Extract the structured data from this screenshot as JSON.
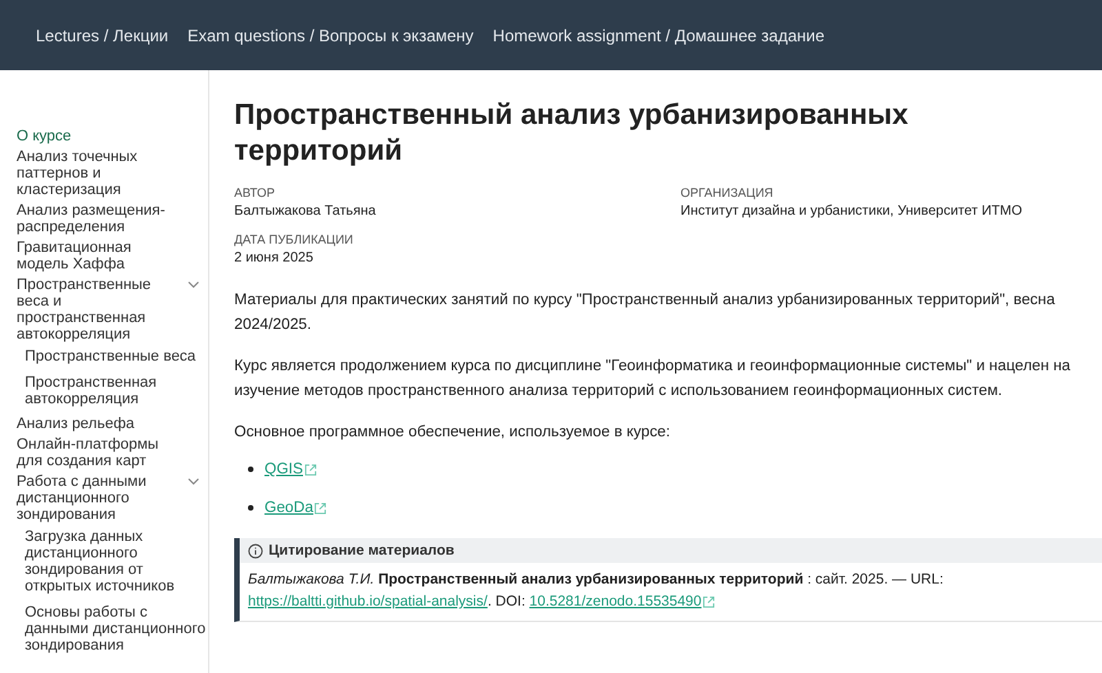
{
  "nav": [
    {
      "label": "Lectures / Лекции",
      "selected": false
    },
    {
      "label": "Exam questions / Вопросы к экзамену",
      "selected": false
    },
    {
      "label": "Homework assignment / Домашнее задание",
      "selected": false
    }
  ],
  "sidebar": {
    "items": [
      {
        "label": "О курсе",
        "selected": true
      },
      {
        "label": "Анализ точечных паттернов и кластеризация",
        "selected": false
      },
      {
        "label": "Анализ размещения-распределения",
        "selected": false
      },
      {
        "label": "Гравитационная модель Хаффа",
        "selected": false
      },
      {
        "label": "Пространственные веса и пространственная автокорреляция",
        "selected": false,
        "expanded": true,
        "children": [
          {
            "label": "Пространственные веса",
            "selected": false
          },
          {
            "label": "Пространственная автокорреляция",
            "selected": false
          }
        ]
      },
      {
        "label": "Анализ рельефа",
        "selected": false
      },
      {
        "label": "Онлайн-платформы для создания карт",
        "selected": false
      },
      {
        "label": "Работа с данными дистанционного зондирования",
        "selected": false,
        "expanded": true,
        "children": [
          {
            "label": "Загрузка данных дистанционного зондирования от открытых источников",
            "selected": false
          },
          {
            "label": "Основы работы с данными дистанционного зондирования",
            "selected": false
          }
        ]
      }
    ]
  },
  "title": "Пространственный анализ урбанизированных территорий",
  "meta": [
    {
      "label": "АВТОР",
      "value": "Балтыжакова Татьяна"
    },
    {
      "label": "ОРГАНИЗАЦИЯ",
      "value": "Институт дизайна и урбанистики, Университет ИТМО"
    },
    {
      "label": "ДАТА ПУБЛИКАЦИИ",
      "value": "2 июня 2025"
    }
  ],
  "paragraphs": [
    "Материалы для практических занятий по курсу \"Пространственный анализ урбанизированных территорий\", весна 2024/2025.",
    "Курс является продолжением курса по дисциплине \"Геоинформатика и геоинформационные системы\" и нацелен на изучение методов пространственного анализа территорий с использованием геоинформационных систем.",
    "Основное программное обеспечение, используемое в курсе:"
  ],
  "software": [
    "QGIS",
    "GeoDa"
  ],
  "callout": {
    "title": "Цитирование материалов",
    "text": "*Балтыжакова Т.И.* **Пространственный анализ урбанизированных территорий** : сайт. 2025. — URL:",
    "url": "https://baltti.github.io/spatial-analysis/",
    "doi_label": ". DOI:",
    "doi": "10.5281/zenodo.15535490"
  }
}
